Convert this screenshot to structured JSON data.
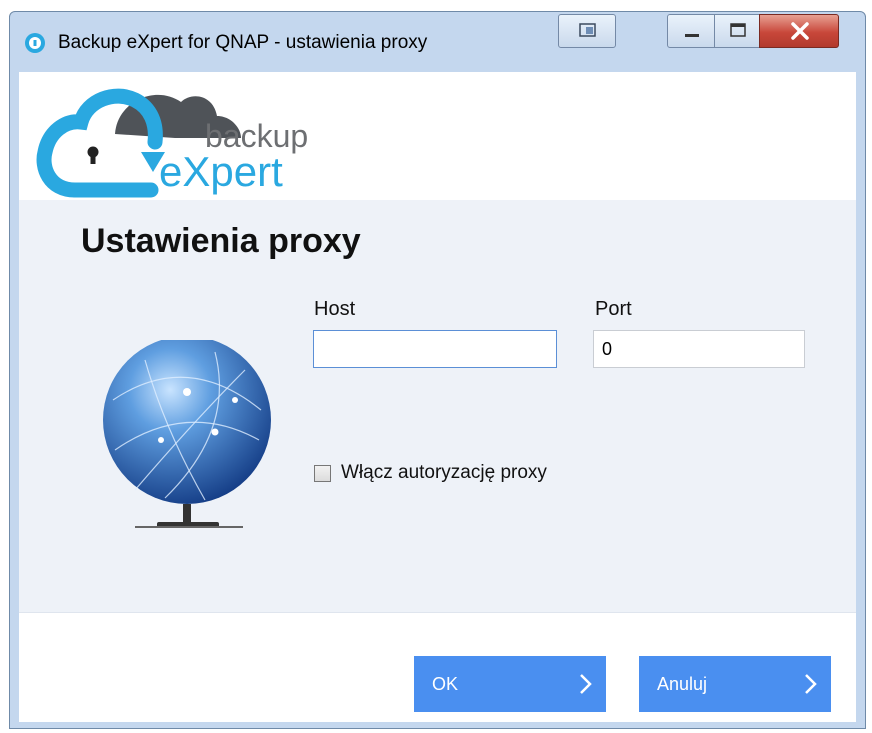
{
  "window": {
    "title": "Backup eXpert for QNAP - ustawienia  proxy"
  },
  "logo": {
    "line1": "backup",
    "line2": "eXpert",
    "colors": {
      "cloud": "#2aa8e0",
      "cloud_dark": "#555a60",
      "text1": "#6d6f72",
      "text2": "#2aa8e0"
    }
  },
  "page": {
    "heading": "Ustawienia proxy"
  },
  "form": {
    "host_label": "Host",
    "host_value": "",
    "port_label": "Port",
    "port_value": "0",
    "auth_checkbox_label": "Włącz autoryzację proxy",
    "auth_checked": false
  },
  "buttons": {
    "ok_label": "OK",
    "cancel_label": "Anuluj"
  },
  "colors": {
    "accent": "#4a8ff0",
    "content_bg": "#eef2f8",
    "close_button": "#c8473a"
  }
}
